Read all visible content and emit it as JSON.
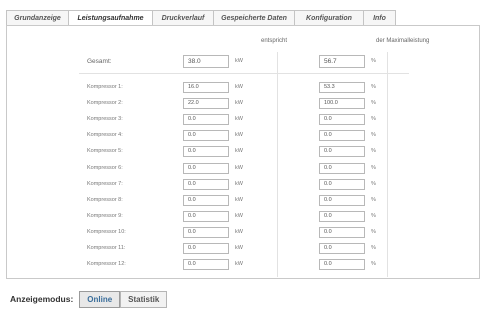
{
  "tabs": [
    {
      "label": "Grundanzeige",
      "active": false
    },
    {
      "label": "Leistungsaufnahme",
      "active": true
    },
    {
      "label": "Druckverlauf",
      "active": false
    },
    {
      "label": "Gespeicherte Daten",
      "active": false
    },
    {
      "label": "Konfiguration",
      "active": false
    },
    {
      "label": "Info",
      "active": false
    }
  ],
  "headers": {
    "entspricht": "entspricht",
    "maximalleistung": "der Maximalleistung"
  },
  "total": {
    "label": "Gesamt:",
    "value": "38.0",
    "unit": "kW",
    "percent": "56.7",
    "percent_unit": "%"
  },
  "compressors": [
    {
      "label": "Kompressor 1:",
      "value": "16.0",
      "unit": "kW",
      "percent": "53.3",
      "percent_unit": "%"
    },
    {
      "label": "Kompressor 2:",
      "value": "22.0",
      "unit": "kW",
      "percent": "100.0",
      "percent_unit": "%"
    },
    {
      "label": "Kompressor 3:",
      "value": "0.0",
      "unit": "kW",
      "percent": "0.0",
      "percent_unit": "%"
    },
    {
      "label": "Kompressor 4:",
      "value": "0.0",
      "unit": "kW",
      "percent": "0.0",
      "percent_unit": "%"
    },
    {
      "label": "Kompressor 5:",
      "value": "0.0",
      "unit": "kW",
      "percent": "0.0",
      "percent_unit": "%"
    },
    {
      "label": "Kompressor 6:",
      "value": "0.0",
      "unit": "kW",
      "percent": "0.0",
      "percent_unit": "%"
    },
    {
      "label": "Kompressor 7:",
      "value": "0.0",
      "unit": "kW",
      "percent": "0.0",
      "percent_unit": "%"
    },
    {
      "label": "Kompressor 8:",
      "value": "0.0",
      "unit": "kW",
      "percent": "0.0",
      "percent_unit": "%"
    },
    {
      "label": "Kompressor 9:",
      "value": "0.0",
      "unit": "kW",
      "percent": "0.0",
      "percent_unit": "%"
    },
    {
      "label": "Kompressor 10:",
      "value": "0.0",
      "unit": "kW",
      "percent": "0.0",
      "percent_unit": "%"
    },
    {
      "label": "Kompressor 11:",
      "value": "0.0",
      "unit": "kW",
      "percent": "0.0",
      "percent_unit": "%"
    },
    {
      "label": "Kompressor 12:",
      "value": "0.0",
      "unit": "kW",
      "percent": "0.0",
      "percent_unit": "%"
    }
  ],
  "mode_bar": {
    "label": "Anzeigemodus:",
    "buttons": [
      {
        "label": "Online",
        "active": true
      },
      {
        "label": "Statistik",
        "active": false
      }
    ]
  }
}
